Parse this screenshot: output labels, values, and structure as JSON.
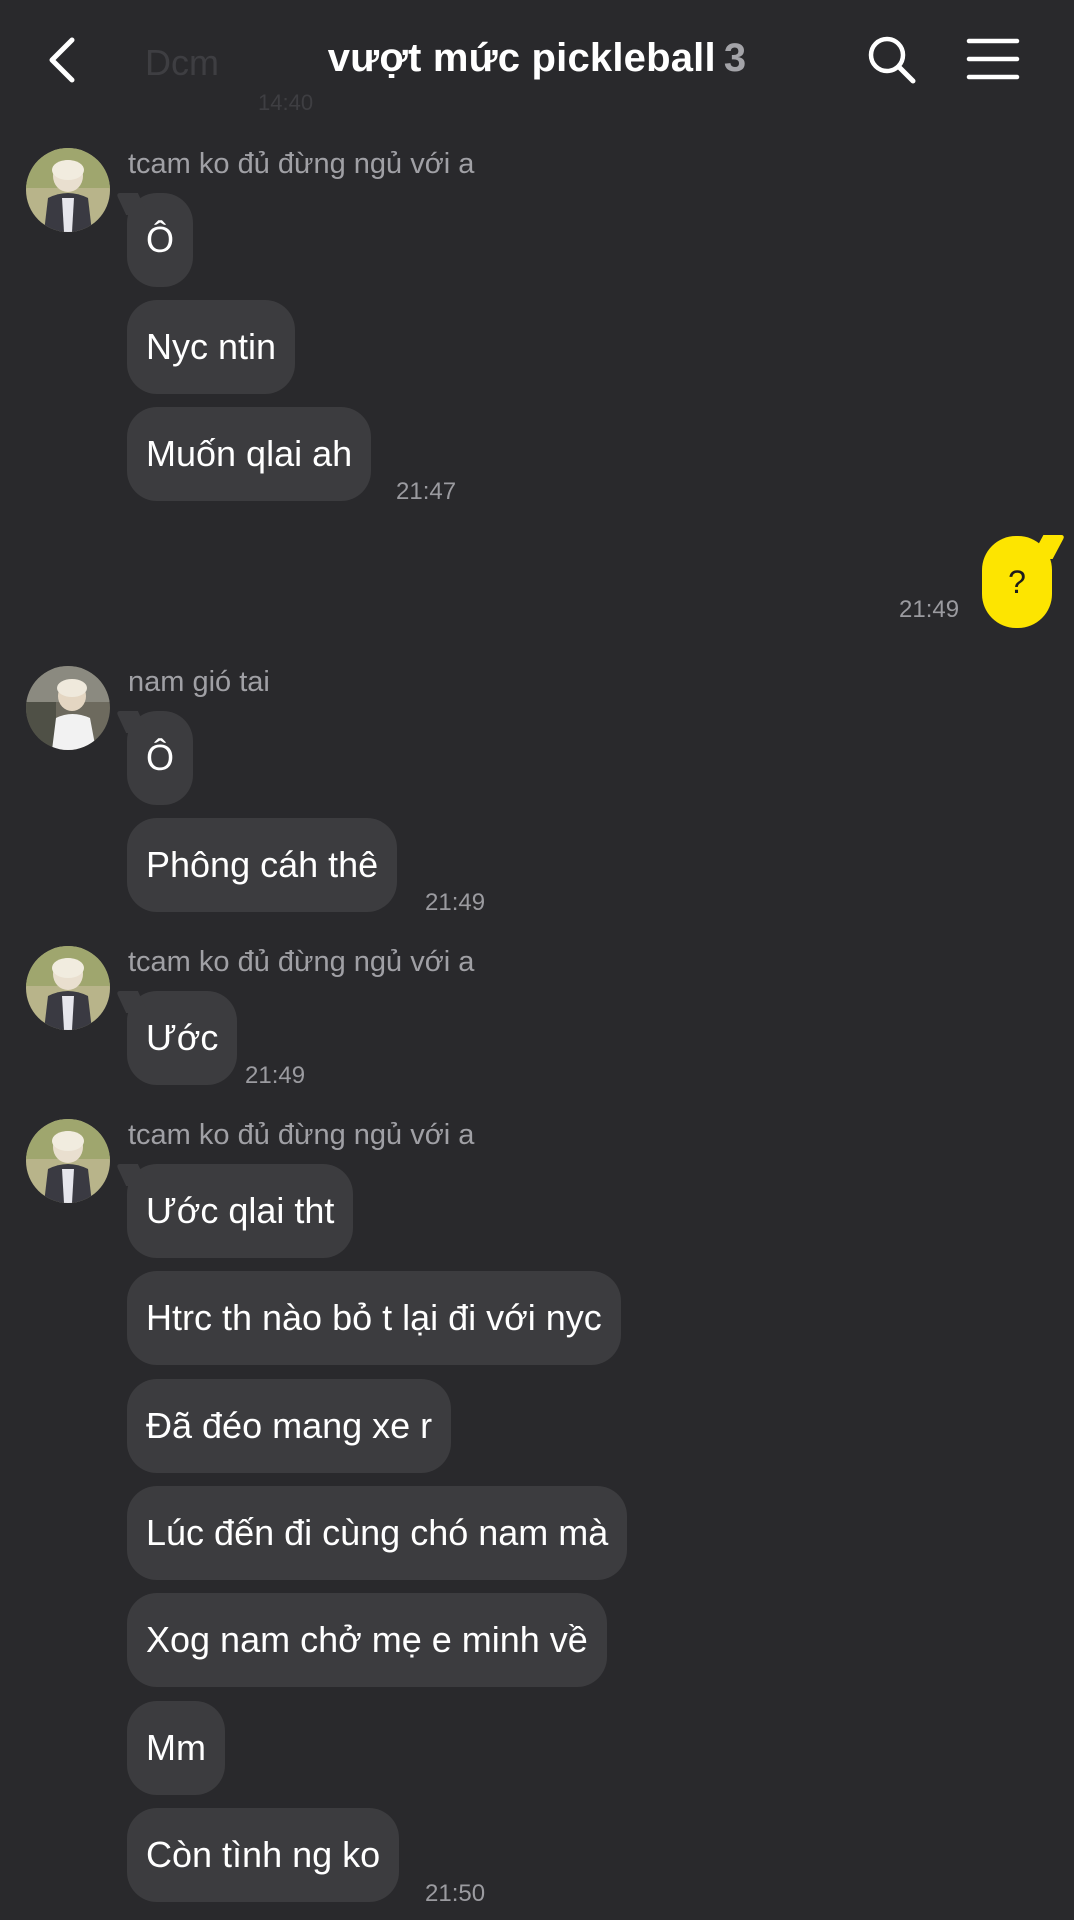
{
  "header": {
    "title": "vượt mức pickleball",
    "member_count": "3",
    "back_icon": "chevron-left-icon",
    "search_icon": "search-icon",
    "menu_icon": "hamburger-menu-icon"
  },
  "ghost": {
    "text": "Dcm",
    "time": "14:40"
  },
  "colors": {
    "background": "#29292c",
    "bubble_other": "#3c3c3f",
    "bubble_mine": "#fde500",
    "timestamp": "#9b9ba0",
    "sender": "#a0a0a5"
  },
  "messages": [
    {
      "sender": "tcam ko đủ đừng ngủ với a",
      "bubbles": [
        "Ô",
        "Nyc ntin",
        "Muốn qlai ah"
      ],
      "time": "21:47"
    },
    {
      "mine": true,
      "bubbles": [
        "?"
      ],
      "time": "21:49"
    },
    {
      "sender": "nam gió tai",
      "bubbles": [
        "Ô",
        "Phông cáh thê"
      ],
      "time": "21:49"
    },
    {
      "sender": "tcam ko đủ đừng ngủ với a",
      "bubbles": [
        "Ước"
      ],
      "time": "21:49"
    },
    {
      "sender": "tcam ko đủ đừng ngủ với a",
      "bubbles": [
        "Ước qlai tht",
        "Htrc th nào bỏ t lại đi với nyc",
        "Đã đéo mang xe r",
        "Lúc đến đi cùng chó nam mà",
        "Xog nam chở mẹ e minh về",
        "Mm",
        "Còn tình ng ko"
      ],
      "time": "21:50"
    }
  ]
}
